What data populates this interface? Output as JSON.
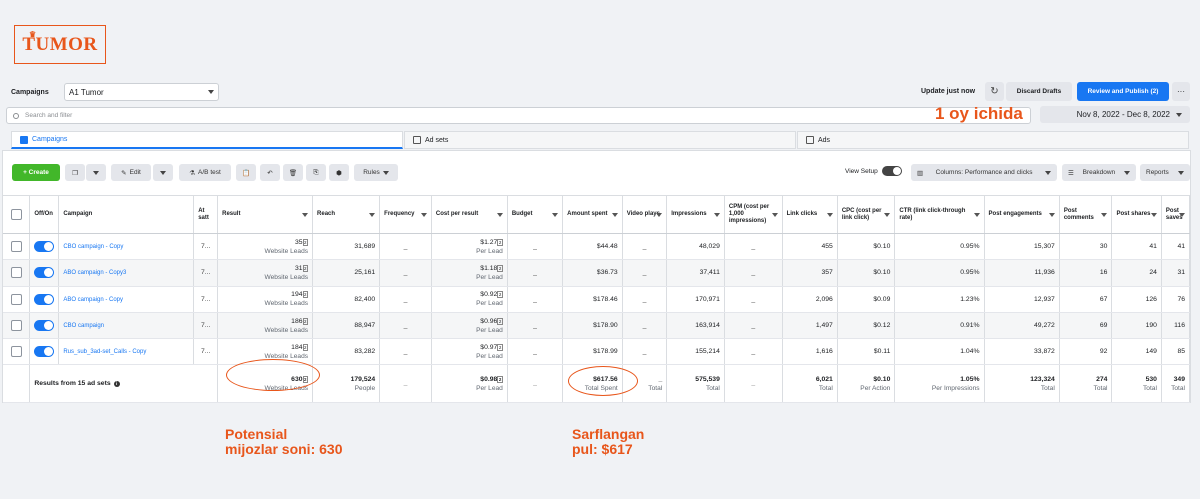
{
  "brand": {
    "logo_text": "TUMOR",
    "accent": "#e8561b"
  },
  "header": {
    "campaigns_label": "Campaigns",
    "account": "A1 Tumor",
    "update_text": "Update just now",
    "discard_label": "Discard Drafts",
    "publish_label": "Review and Publish (2)",
    "more_label": "···"
  },
  "search": {
    "placeholder": "Search and filter"
  },
  "date_range": "Nov 8, 2022 - Dec 8, 2022",
  "tabs": [
    {
      "label": "Campaigns"
    },
    {
      "label": "Ad sets"
    },
    {
      "label": "Ads"
    }
  ],
  "toolbar": {
    "create": "+ Create",
    "edit": "Edit",
    "ab_test": "A/B test",
    "rules": "Rules",
    "view_setup": "View Setup",
    "columns": "Columns: Performance and clicks",
    "breakdown": "Breakdown",
    "reports": "Reports"
  },
  "columns": [
    "Off/On",
    "Campaign",
    "At satt",
    "Result",
    "Reach",
    "Frequency",
    "Cost per result",
    "Budget",
    "Amount spent",
    "Video plays",
    "Impressions",
    "CPM (cost per 1,000 impressions)",
    "Link clicks",
    "CPC (cost per link click)",
    "CTR (link click-through rate)",
    "Post engagements",
    "Post comments",
    "Post shares",
    "Post saves"
  ],
  "rows": [
    {
      "name": "CBO campaign - Copy",
      "att": "7...",
      "result": "35",
      "result_sub": "Website Leads",
      "reach": "31,689",
      "freq": "_",
      "cpr": "$1.27",
      "cpr_sub": "Per Lead",
      "budget": "_",
      "spent": "$44.48",
      "video": "_",
      "impr": "48,029",
      "cpm": "_",
      "clicks": "455",
      "cpc": "$0.10",
      "ctr": "0.95%",
      "eng": "15,307",
      "comments": "30",
      "shares": "41",
      "saves": "41"
    },
    {
      "name": "ABO campaign - Copy3",
      "att": "7...",
      "result": "31",
      "result_sub": "Website Leads",
      "reach": "25,161",
      "freq": "_",
      "cpr": "$1.18",
      "cpr_sub": "Per Lead",
      "budget": "_",
      "spent": "$36.73",
      "video": "_",
      "impr": "37,411",
      "cpm": "_",
      "clicks": "357",
      "cpc": "$0.10",
      "ctr": "0.95%",
      "eng": "11,936",
      "comments": "16",
      "shares": "24",
      "saves": "31"
    },
    {
      "name": "ABO campaign - Copy",
      "att": "7...",
      "result": "194",
      "result_sub": "Website Leads",
      "reach": "82,400",
      "freq": "_",
      "cpr": "$0.92",
      "cpr_sub": "Per Lead",
      "budget": "_",
      "spent": "$178.46",
      "video": "_",
      "impr": "170,971",
      "cpm": "_",
      "clicks": "2,096",
      "cpc": "$0.09",
      "ctr": "1.23%",
      "eng": "12,937",
      "comments": "67",
      "shares": "126",
      "saves": "76"
    },
    {
      "name": "CBO campaign",
      "att": "7...",
      "result": "186",
      "result_sub": "Website Leads",
      "reach": "88,947",
      "freq": "_",
      "cpr": "$0.96",
      "cpr_sub": "Per Lead",
      "budget": "_",
      "spent": "$178.90",
      "video": "_",
      "impr": "163,914",
      "cpm": "_",
      "clicks": "1,497",
      "cpc": "$0.12",
      "ctr": "0.91%",
      "eng": "49,272",
      "comments": "69",
      "shares": "190",
      "saves": "116"
    },
    {
      "name": "Rus_sub_3ad-set_Calls - Copy",
      "att": "7...",
      "result": "184",
      "result_sub": "Website Leads",
      "reach": "83,282",
      "freq": "_",
      "cpr": "$0.97",
      "cpr_sub": "Per Lead",
      "budget": "_",
      "spent": "$178.99",
      "video": "_",
      "impr": "155,214",
      "cpm": "_",
      "clicks": "1,616",
      "cpc": "$0.11",
      "ctr": "1.04%",
      "eng": "33,872",
      "comments": "92",
      "shares": "149",
      "saves": "85"
    }
  ],
  "totals": {
    "label": "Results from 15 ad sets",
    "result": "630",
    "result_sub": "Website Leads",
    "reach": "179,524",
    "reach_sub": "People",
    "freq": "_",
    "cpr": "$0.98",
    "cpr_sub": "Per Lead",
    "budget": "_",
    "spent": "$617.56",
    "spent_sub": "Total Spent",
    "video": "_",
    "video_sub": "Total",
    "impr": "575,539",
    "impr_sub": "Total",
    "cpm": "_",
    "clicks": "6,021",
    "clicks_sub": "Total",
    "cpc": "$0.10",
    "cpc_sub": "Per Action",
    "ctr": "1.05%",
    "ctr_sub": "Per Impressions",
    "eng": "123,324",
    "eng_sub": "Total",
    "comments": "274",
    "comments_sub": "Total",
    "shares": "530",
    "shares_sub": "Total",
    "saves": "349",
    "saves_sub": "Total"
  },
  "annotations": {
    "period": "1 oy ichida",
    "leads_line1": "Potensial",
    "leads_line2": "mijozlar soni: 630",
    "spent_line1": "Sarflangan",
    "spent_line2": "pul: $617"
  }
}
